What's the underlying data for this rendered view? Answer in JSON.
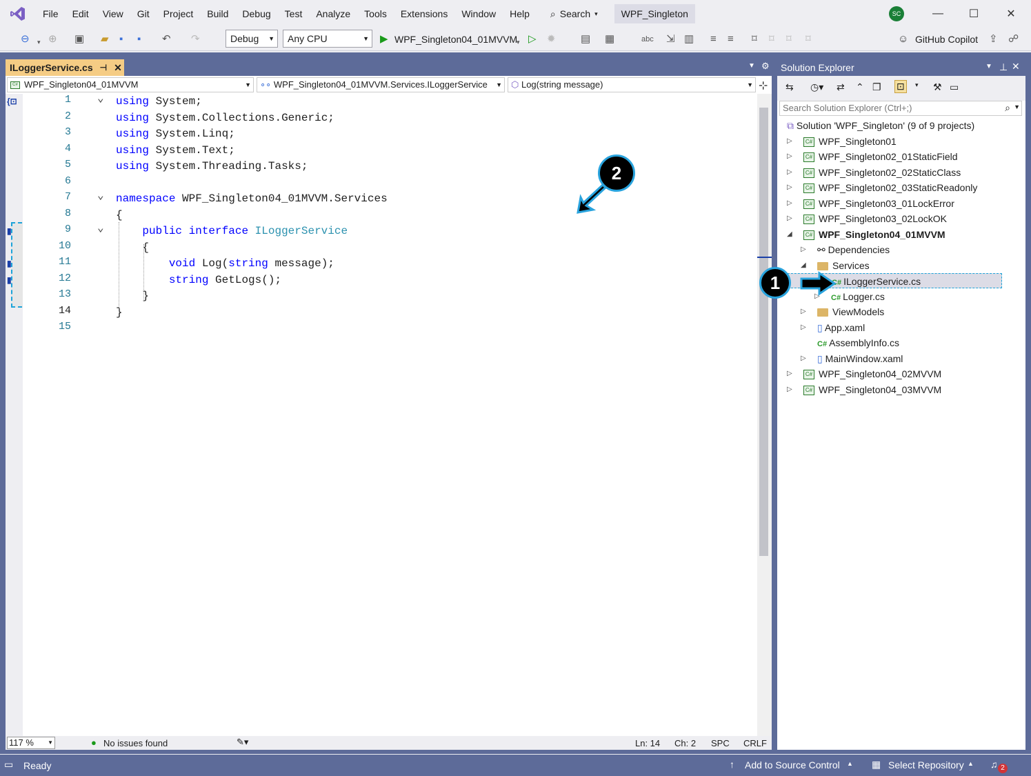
{
  "menu": [
    "File",
    "Edit",
    "View",
    "Git",
    "Project",
    "Build",
    "Debug",
    "Test",
    "Analyze",
    "Tools",
    "Extensions",
    "Window",
    "Help"
  ],
  "search_label": "Search",
  "solution_name": "WPF_Singleton",
  "avatar_initials": "SC",
  "toolbar": {
    "config": "Debug",
    "platform": "Any CPU",
    "startup": "WPF_Singleton04_01MVVM",
    "copilot": "GitHub Copilot"
  },
  "editor": {
    "tab_title": "ILoggerService.cs",
    "nav_project": "WPF_Singleton04_01MVVM",
    "nav_type": "WPF_Singleton04_01MVVM.Services.ILoggerService",
    "nav_member": "Log(string message)",
    "lines": [
      {
        "n": "1",
        "text": "using System;"
      },
      {
        "n": "2",
        "text": "using System.Collections.Generic;"
      },
      {
        "n": "3",
        "text": "using System.Linq;"
      },
      {
        "n": "4",
        "text": "using System.Text;"
      },
      {
        "n": "5",
        "text": "using System.Threading.Tasks;"
      },
      {
        "n": "6",
        "text": ""
      },
      {
        "n": "7",
        "text": "namespace WPF_Singleton04_01MVVM.Services"
      },
      {
        "n": "8",
        "text": "{"
      },
      {
        "n": "9",
        "text": "    public interface ILoggerService"
      },
      {
        "n": "10",
        "text": "    {"
      },
      {
        "n": "11",
        "text": "        void Log(string message);"
      },
      {
        "n": "12",
        "text": "        string GetLogs();"
      },
      {
        "n": "13",
        "text": "    }"
      },
      {
        "n": "14",
        "text": "}"
      },
      {
        "n": "15",
        "text": ""
      }
    ],
    "zoom": "117 %",
    "issues": "No issues found",
    "ln": "Ln: 14",
    "ch": "Ch: 2",
    "spc": "SPC",
    "crlf": "CRLF"
  },
  "solution_explorer": {
    "title": "Solution Explorer",
    "search_placeholder": "Search Solution Explorer (Ctrl+;)",
    "nodes": [
      {
        "label": "Solution 'WPF_Singleton' (9 of 9 projects)",
        "kind": "solution"
      },
      {
        "label": "WPF_Singleton01",
        "kind": "project"
      },
      {
        "label": "WPF_Singleton02_01StaticField",
        "kind": "project"
      },
      {
        "label": "WPF_Singleton02_02StaticClass",
        "kind": "project"
      },
      {
        "label": "WPF_Singleton02_03StaticReadonly",
        "kind": "project"
      },
      {
        "label": "WPF_Singleton03_01LockError",
        "kind": "project"
      },
      {
        "label": "WPF_Singleton03_02LockOK",
        "kind": "project"
      },
      {
        "label": "WPF_Singleton04_01MVVM",
        "kind": "project-open"
      },
      {
        "label": "Dependencies",
        "kind": "deps"
      },
      {
        "label": "Services",
        "kind": "folder-open"
      },
      {
        "label": "ILoggerService.cs",
        "kind": "cs-selected"
      },
      {
        "label": "Logger.cs",
        "kind": "cs"
      },
      {
        "label": "ViewModels",
        "kind": "folder"
      },
      {
        "label": "App.xaml",
        "kind": "xaml"
      },
      {
        "label": "AssemblyInfo.cs",
        "kind": "cs"
      },
      {
        "label": "MainWindow.xaml",
        "kind": "xaml"
      },
      {
        "label": "WPF_Singleton04_02MVVM",
        "kind": "project"
      },
      {
        "label": "WPF_Singleton04_03MVVM",
        "kind": "project"
      }
    ]
  },
  "statusbar": {
    "ready": "Ready",
    "source_control": "Add to Source Control",
    "repo": "Select Repository",
    "notifications": "2"
  },
  "callouts": {
    "one": "1",
    "two": "2"
  },
  "colors": {
    "accent": "#5d6b99",
    "tab": "#f5cc84",
    "keyword": "#0000ff",
    "type": "#2b91af",
    "callout_border": "#29a3dd"
  }
}
